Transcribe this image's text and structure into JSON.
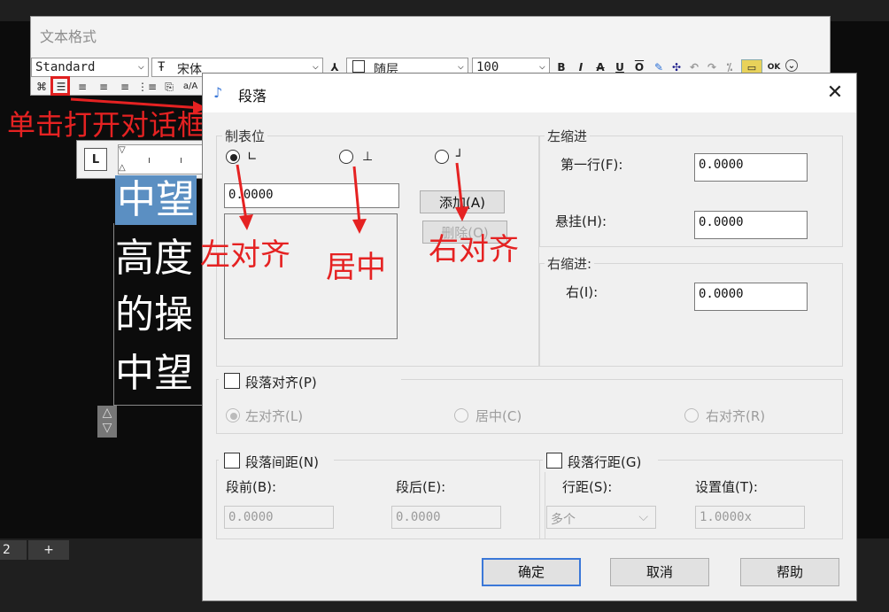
{
  "text_format": {
    "title": "文本格式",
    "style_combo": "Standard",
    "font_combo": "宋体",
    "font_icon": "TT-font-icon",
    "layer_combo": "随层",
    "height_combo": "100",
    "toolbar": [
      "B",
      "I",
      "A",
      "U",
      "O",
      "OK"
    ]
  },
  "cad_text": {
    "ruler_tab": "L",
    "lines": [
      "中望",
      "高度",
      "的操",
      "中望"
    ],
    "scroll_symbol": "⇳"
  },
  "annotations": {
    "open_dialog": "单击打开对话框",
    "left_align": "左对齐",
    "center": "居中",
    "right_align": "右对齐",
    "color": "#e52222"
  },
  "bottom": {
    "tab_num": "2",
    "tab_add": "+"
  },
  "dialog": {
    "title": "段落",
    "tabs": {
      "group_label": "制表位",
      "left_glyph": "∟",
      "center_glyph": "⊥",
      "right_glyph": "┘",
      "selected": "left",
      "value": "0.0000",
      "add_button": "添加(A)",
      "delete_button": "删除(O)"
    },
    "left_indent": {
      "group_label": "左缩进",
      "first_line_label": "第一行(F):",
      "first_line_value": "0.0000",
      "hanging_label": "悬挂(H):",
      "hanging_value": "0.0000"
    },
    "right_indent": {
      "group_label": "右缩进:",
      "right_label": "右(I):",
      "right_value": "0.0000"
    },
    "paragraph_align": {
      "checkbox_label": "段落对齐(P)",
      "checked": false,
      "options": [
        "左对齐(L)",
        "居中(C)",
        "右对齐(R)"
      ],
      "selected": "左对齐(L)"
    },
    "paragraph_spacing": {
      "checkbox_label": "段落间距(N)",
      "before_label": "段前(B):",
      "before_value": "0.0000",
      "after_label": "段后(E):",
      "after_value": "0.0000"
    },
    "line_spacing": {
      "checkbox_label": "段落行距(G)",
      "spacing_label": "行距(S):",
      "spacing_value": "多个",
      "set_label": "设置值(T):",
      "set_value": "1.0000x"
    },
    "buttons": {
      "ok": "确定",
      "cancel": "取消",
      "help": "帮助"
    }
  }
}
